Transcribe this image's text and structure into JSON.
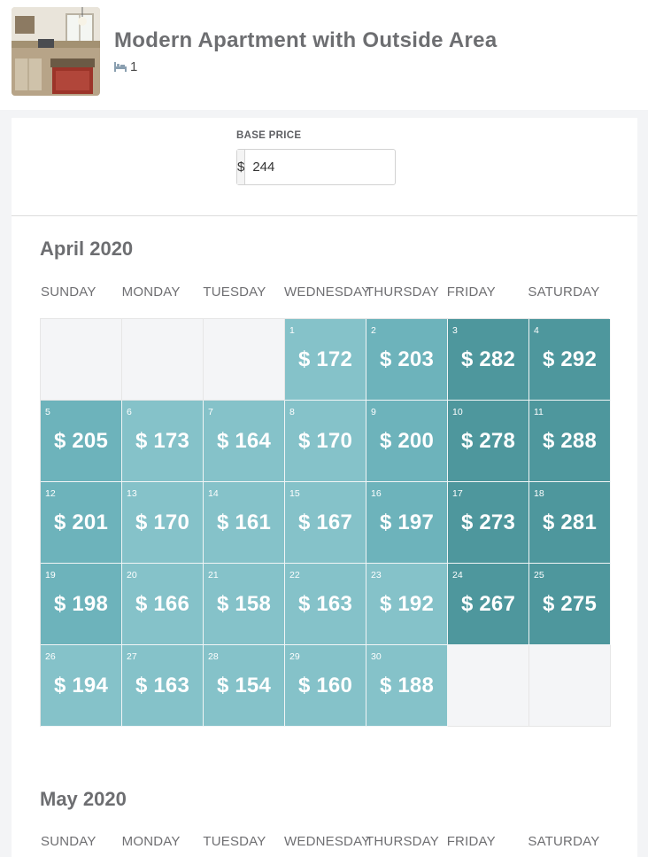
{
  "listing": {
    "title": "Modern Apartment with Outside Area",
    "bed_count": "1",
    "bed_icon": "bed-icon",
    "thumbnail": "kitchen-photo"
  },
  "pricing": {
    "base_price_label": "BASE PRICE",
    "currency_symbol": "$",
    "base_price_value": "244"
  },
  "colors": {
    "tier_low": "#85c2c9",
    "tier_mid": "#6db3bb",
    "tier_high": "#4e979d",
    "empty_cell": "#f4f5f7"
  },
  "weekdays": [
    "SUNDAY",
    "MONDAY",
    "TUESDAY",
    "WEDNESDAY",
    "THURSDAY",
    "FRIDAY",
    "SATURDAY"
  ],
  "months": [
    {
      "title": "April 2020",
      "days": [
        {
          "day": "1",
          "price": "$ 172",
          "tier": "t1"
        },
        {
          "day": "2",
          "price": "$ 203",
          "tier": "t2"
        },
        {
          "day": "3",
          "price": "$ 282",
          "tier": "t3"
        },
        {
          "day": "4",
          "price": "$ 292",
          "tier": "t3"
        },
        {
          "day": "5",
          "price": "$ 205",
          "tier": "t2"
        },
        {
          "day": "6",
          "price": "$ 173",
          "tier": "t1"
        },
        {
          "day": "7",
          "price": "$ 164",
          "tier": "t1"
        },
        {
          "day": "8",
          "price": "$ 170",
          "tier": "t1"
        },
        {
          "day": "9",
          "price": "$ 200",
          "tier": "t2"
        },
        {
          "day": "10",
          "price": "$ 278",
          "tier": "t3"
        },
        {
          "day": "11",
          "price": "$ 288",
          "tier": "t3"
        },
        {
          "day": "12",
          "price": "$ 201",
          "tier": "t2"
        },
        {
          "day": "13",
          "price": "$ 170",
          "tier": "t1"
        },
        {
          "day": "14",
          "price": "$ 161",
          "tier": "t1"
        },
        {
          "day": "15",
          "price": "$ 167",
          "tier": "t1"
        },
        {
          "day": "16",
          "price": "$ 197",
          "tier": "t2"
        },
        {
          "day": "17",
          "price": "$ 273",
          "tier": "t3"
        },
        {
          "day": "18",
          "price": "$ 281",
          "tier": "t3"
        },
        {
          "day": "19",
          "price": "$ 198",
          "tier": "t2"
        },
        {
          "day": "20",
          "price": "$ 166",
          "tier": "t1"
        },
        {
          "day": "21",
          "price": "$ 158",
          "tier": "t1"
        },
        {
          "day": "22",
          "price": "$ 163",
          "tier": "t1"
        },
        {
          "day": "23",
          "price": "$ 192",
          "tier": "t1"
        },
        {
          "day": "24",
          "price": "$ 267",
          "tier": "t3"
        },
        {
          "day": "25",
          "price": "$ 275",
          "tier": "t3"
        },
        {
          "day": "26",
          "price": "$ 194",
          "tier": "t1"
        },
        {
          "day": "27",
          "price": "$ 163",
          "tier": "t1"
        },
        {
          "day": "28",
          "price": "$ 154",
          "tier": "t1"
        },
        {
          "day": "29",
          "price": "$ 160",
          "tier": "t1"
        },
        {
          "day": "30",
          "price": "$ 188",
          "tier": "t1"
        }
      ]
    },
    {
      "title": "May 2020",
      "days": []
    }
  ]
}
